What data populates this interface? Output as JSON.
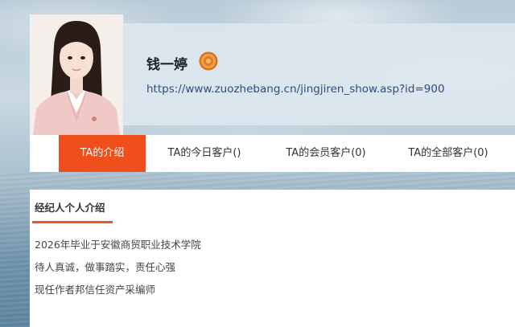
{
  "profile": {
    "name": "钱一婷",
    "url": "https://www.zuozhebang.cn/jingjiren_show.asp?id=900",
    "badge_icon": "medal-icon"
  },
  "tabs": [
    {
      "label": "TA的介绍",
      "active": true
    },
    {
      "label": "TA的今日客户()",
      "active": false
    },
    {
      "label": "TA的会员客户(0)",
      "active": false
    },
    {
      "label": "TA的全部客户(0)",
      "active": false
    }
  ],
  "intro": {
    "title": "经纪人个人介绍",
    "lines": [
      "2026年毕业于安徽商贸职业技术学院",
      "待人真诚，做事踏实，责任心强",
      "现任作者邦信任资产采编师"
    ]
  },
  "colors": {
    "accent": "#f04e1a",
    "underline": "#e8581e",
    "link": "#2f4d7c"
  }
}
